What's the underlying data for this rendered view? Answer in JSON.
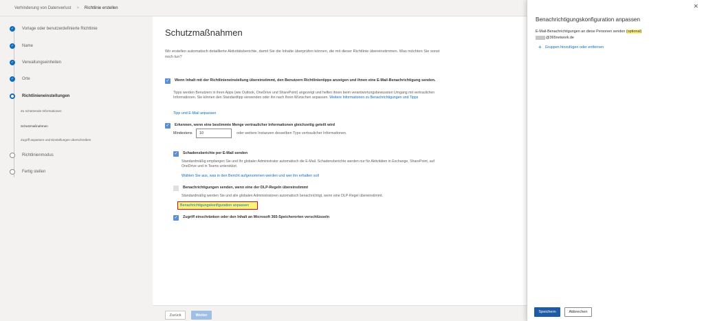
{
  "breadcrumb": {
    "parent": "Verhinderung von Datenverlust",
    "separator": ">",
    "current": "Richtlinie erstellen"
  },
  "steps": [
    {
      "label": "Vorlage oder benutzerdefinierte Richtlinie",
      "state": "done"
    },
    {
      "label": "Name",
      "state": "done"
    },
    {
      "label": "Verwaltungseinheiten",
      "state": "done"
    },
    {
      "label": "Orte",
      "state": "done"
    },
    {
      "label": "Richtlinieneinstellungen",
      "state": "current"
    },
    {
      "label": "Richtlinienmodus",
      "state": "pending"
    },
    {
      "label": "Fertig stellen",
      "state": "pending"
    }
  ],
  "substeps": [
    "Zu schützende Informationen",
    "Schutzmaßnahmen",
    "Zugriff anpassen und Einstellungen überschreiben"
  ],
  "main": {
    "title": "Schutzmaßnahmen",
    "intro": "Wir erstellen automatisch detaillierte Aktivitätsberichte, damit Sie die Inhalte überprüfen können, die mit dieser Richtlinie übereinstimmen. Was möchten Sie sonst noch tun?",
    "opt1_label": "Wenn Inhalt mit der Richtlinieneinstellung übereinstimmt, den Benutzern Richtlinientipps anzeigen und ihnen eine E-Mail-Benachrichtigung senden.",
    "opt1_desc": "Tipps werden Benutzern in ihren Apps (wie Outlook, OneDrive und SharePoint) angezeigt und helfen ihnen beim verantwortungsbewussten Umgang mit vertraulichen Informationen. Sie können den Standardtipp verwenden oder ihn nach Ihren Wünschen anpassen.",
    "opt1_desc_link": "Weitere Informationen zu Benachrichtigungen und Tipps",
    "opt1_link": "Tipp und E-Mail anpassen",
    "opt2_label": "Erkennen, wenn eine bestimmte Menge vertraulicher Informationen gleichzeitig geteilt wird",
    "min_label": "Mindestens",
    "min_value": "10",
    "min_suffix": "oder weitere Instanzen desselben Typs vertraulicher Informationen.",
    "opt3_label": "Schadensberichte per E-Mail senden",
    "opt3_desc": "Standardmäßig empfangen Sie und Ihr globaler Administrator automatisch die E-Mail. Schadensberichte werden nur für Aktivitäten in Exchange, SharePoint, auf OneDrive und in Teams unterstützt.",
    "opt3_link": "Wählen Sie aus, was in den Bericht aufgenommen werden und wer ihn erhalten soll",
    "opt4_label": "Benachrichtigungen senden, wenn eine der DLP-Regeln übereinstimmt",
    "opt4_desc": "Standardmäßig werden Sie und alle globalen Administratoren automatisch benachrichtigt, wenn eine DLP-Regel übereinstimmt.",
    "opt4_link": "Benachrichtigungskonfiguration anpassen",
    "opt5_label": "Zugriff einschränken oder den Inhalt an Microsoft 365-Speicherorten verschlüsseln",
    "back": "Zurück",
    "next": "Weiter"
  },
  "panel": {
    "title": "Benachrichtigungskonfiguration anpassen",
    "notify_label": "E-Mail-Benachrichtigungen an diese Personen senden",
    "optional": "(optional)",
    "recipient_domain": "@365network.de",
    "add_groups": "Gruppen hinzufügen oder entfernen",
    "close": "✕",
    "save": "Speichern",
    "cancel": "Abbrechen"
  },
  "colors": {
    "accent": "#0f6cbd",
    "highlight": "#fff27a",
    "highlight_border": "#c50f1f"
  }
}
